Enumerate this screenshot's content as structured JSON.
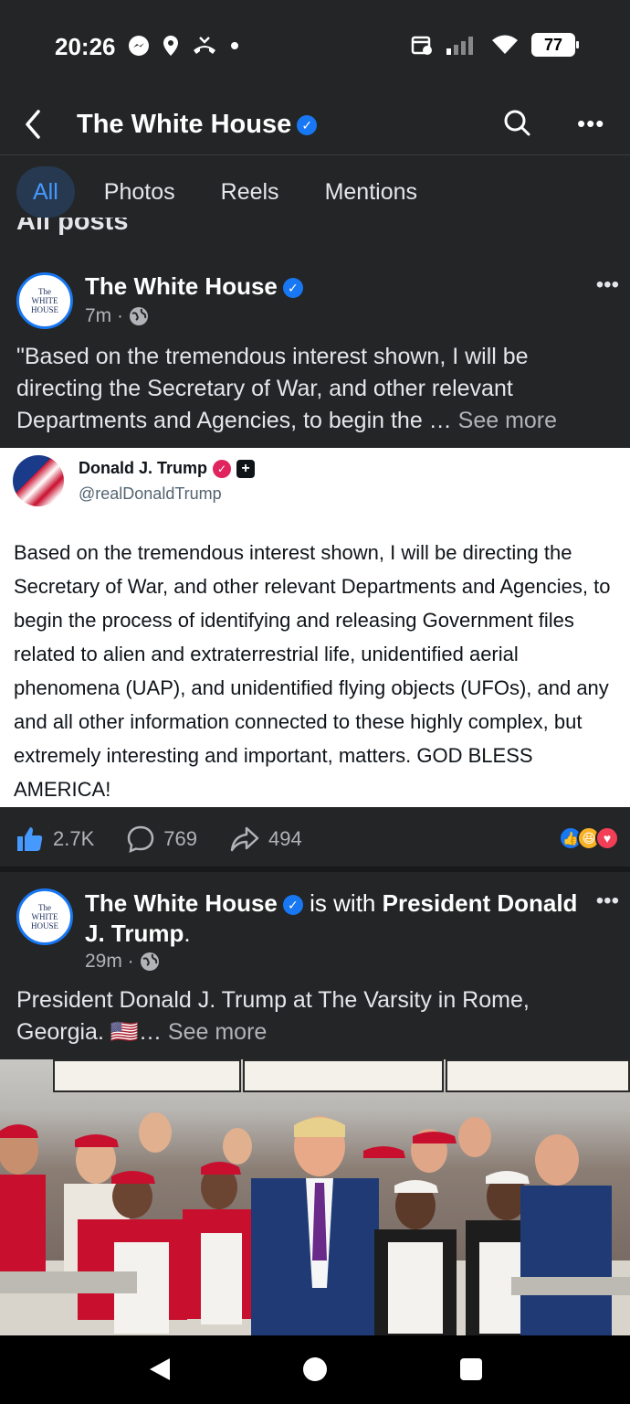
{
  "status_bar": {
    "time": "20:26",
    "battery": "77",
    "left_icons": [
      "messenger-icon",
      "location-icon",
      "missed-call-icon",
      "dot-icon"
    ],
    "right_icons": [
      "calendar-icon",
      "signal-icon",
      "wifi-icon",
      "battery-icon"
    ]
  },
  "header": {
    "title": "The White House",
    "more": "•••"
  },
  "tabs": [
    {
      "label": "All",
      "active": true
    },
    {
      "label": "Photos"
    },
    {
      "label": "Reels"
    },
    {
      "label": "Mentions"
    }
  ],
  "section_title": "All posts",
  "post1": {
    "author": "The White House",
    "time": "7m ·",
    "avatar_text": [
      "The",
      "WHITE",
      "HOUSE"
    ],
    "text": "\"Based on the tremendous interest shown, I will be directing the Secretary of War, and other relevant Departments and Agencies, to begin the … ",
    "see_more": "See more",
    "embed": {
      "name": "Donald J. Trump",
      "handle": "@realDonaldTrump",
      "body": "Based on the tremendous interest shown, I will be directing the Secretary of War, and other relevant Departments and Agencies, to begin the process of identifying and releasing Government files related to alien and extraterrestrial life, unidentified aerial phenomena (UAP), and unidentified flying objects (UFOs), and any and all other information connected to these highly complex, but extremely interesting and important, matters. GOD BLESS AMERICA!"
    },
    "likes": "2.7K",
    "comments": "769",
    "shares": "494"
  },
  "post2": {
    "author": "The White House",
    "with_text": "is with",
    "with_person": "President Donald J. Trump",
    "period": ".",
    "time": "29m ·",
    "avatar_text": [
      "The",
      "WHITE",
      "HOUSE"
    ],
    "text": "President Donald J. Trump at The Varsity in Rome, Georgia. 🇺🇸… ",
    "see_more": "See more"
  },
  "colors": {
    "background": "#242526",
    "accent": "#1877f2",
    "tab_active_bg": "#263951",
    "tab_active_text": "#4599ff"
  }
}
